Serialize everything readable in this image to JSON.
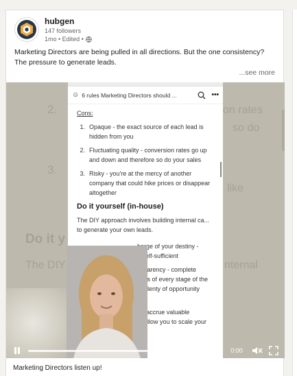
{
  "post": {
    "author_name": "hubgen",
    "followers": "147 followers",
    "meta": "1mo • Edited •",
    "text_line1": "Marketing Directors are being pulled in all directions. But the one consistency?",
    "text_line2": "The pressure to generate leads.",
    "see_more": "...see more"
  },
  "video": {
    "time": "0:00",
    "progress": 0,
    "icons": {
      "play_pause": "pause-icon",
      "volume": "mute-icon",
      "fullscreen": "fullscreen-icon"
    },
    "background_text": {
      "n2": "2.",
      "n3": "3.",
      "rates": "on rates",
      "so_do": "so do",
      "like": "like",
      "do_it": "Do it y",
      "the_diy": "The DIY",
      "internal": "nternal"
    },
    "phone": {
      "title": "6 rules Marketing Directors should ...",
      "cons_label": "Cons:",
      "cons": [
        {
          "num": "1.",
          "text": "Opaque - the exact source of each lead is hidden from you"
        },
        {
          "num": "2.",
          "text": "Fluctuating quality - conversion rates go up and down and therefore so do your sales"
        },
        {
          "num": "3.",
          "text": "Risky - you're at the mercy of another company that could hike prices or disappear altogether"
        }
      ],
      "section_title": "Do it yourself (in-house)",
      "paragraph": "The DIY approach involves building internal ca... to generate your own leads.",
      "partial_1": "harge of your destiny -",
      "partial_2": "e self-sufficient",
      "partial_3": "nsparency - complete",
      "partial_4": "ness of every stage of the",
      "partial_5": "rs plenty of opportunity",
      "partial_6": "tion",
      "partial_7": "u'll accrue valuable",
      "partial_8": "at allow you to scale your"
    }
  },
  "caption": "Marketing Directors listen up!"
}
